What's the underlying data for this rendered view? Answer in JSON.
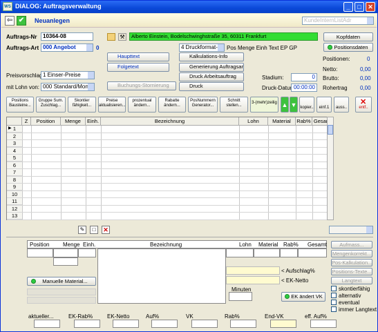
{
  "window": {
    "title": "DIALOG: Auftragsverwaltung",
    "app_icon": "WS",
    "min": "_",
    "max": "□",
    "close": "✕"
  },
  "header": {
    "mode": "Neuanlegen",
    "customer_placeholder": "KundeInternListAdr"
  },
  "form": {
    "auftrags_nr_label": "Auftrags-Nr",
    "auftrags_nr": "10364-08",
    "auftrags_art_label": "Auftrags-Art",
    "auftrags_art": "000 Angebot",
    "auftrags_art_num": "0",
    "address": "Alberto Einstein, Bodelschwinghstraße 35, 60311 Frankfurt",
    "druckformat": "4 Druckformat-4",
    "pos_menge_text": "Pos Menge Einh Text EP GP",
    "preisvorschlag_label": "Preisvorschlag:",
    "preisvorschlag": "1  Einser-Preise",
    "mit_lohn_label": "mit Lohn von:",
    "mit_lohn": "000 Standard/Monte",
    "btn_haupttext": "Haupttext",
    "btn_folgetext": "Folgetext",
    "btn_buchungs": "Buchungs-Stornierung",
    "btn_kalk": "Kalkulations-Info",
    "btn_gen": "Generierung Auftragsarten",
    "btn_druck_arb": "Druck Arbeitsauftrag",
    "btn_druck": "Druck",
    "stadium_label": "Stadium:",
    "stadium": "0",
    "druck_datum_label": "Druck-Datum:",
    "druck_datum": "00:00:00",
    "btn_kopfdaten": "Kopfdaten",
    "btn_positionsdaten": "Positionsdaten",
    "positionen_label": "Positionen:",
    "positionen": "0",
    "netto_label": "Netto:",
    "netto": "0,00",
    "brutto_label": "Brutto:",
    "brutto": "0,00",
    "rohertrag_label": "Rohertrag",
    "rohertrag": "0,00"
  },
  "toolbar": {
    "b1": "Positions Bausteine...",
    "b2": "Gruppe Sum. Zuschlag...",
    "b3": "Skontier fähigkeit...",
    "b4": "Preise aktualisieren...",
    "b5": "prozentual ändern...",
    "b6": "Rabatte ändern...",
    "b7": "PosNummern Generator...",
    "b8": "Schnitt stellen...",
    "b9": "3-(mehr)zeilig",
    "b10": "kopier..",
    "b11": "einf.1",
    "b12": "auss..",
    "b13": "entf.."
  },
  "grid": {
    "columns": [
      "",
      "Z",
      "Position",
      "Menge",
      "Einh.",
      "Bezeichnung",
      "Lohn",
      "Material",
      "Rab%",
      "Gesamt"
    ],
    "rows": [
      "1",
      "2",
      "3",
      "4",
      "5",
      "6",
      "7",
      "8",
      "9",
      "10",
      "11",
      "12",
      "13"
    ]
  },
  "detail": {
    "columns": [
      "Position",
      "Menge",
      "Einh.",
      "Bezeichnung",
      "Lohn",
      "Material",
      "Rab%",
      "Gesamt"
    ],
    "aufschlag_label": "< Aufschlag%",
    "ek_netto_label": "< EK-Netto",
    "minuten_label": "Minuten",
    "btn_manuelle": "Manuelle Material...",
    "btn_ek": "EK ändert VK",
    "side_btns": [
      "Aufmass...",
      "Mengenkorrekt...",
      "Pos-Kalkulation...",
      "Positions-Texte...",
      "Langtext"
    ],
    "checks": [
      "skontierfähig",
      "alternativ",
      "eventual",
      "immer Langtext"
    ],
    "footer": [
      "aktueller...",
      "EK-Rab%",
      "EK-Netto",
      "Auf%",
      "VK",
      "Rab%",
      "End-VK",
      "eff. Auf%"
    ]
  }
}
